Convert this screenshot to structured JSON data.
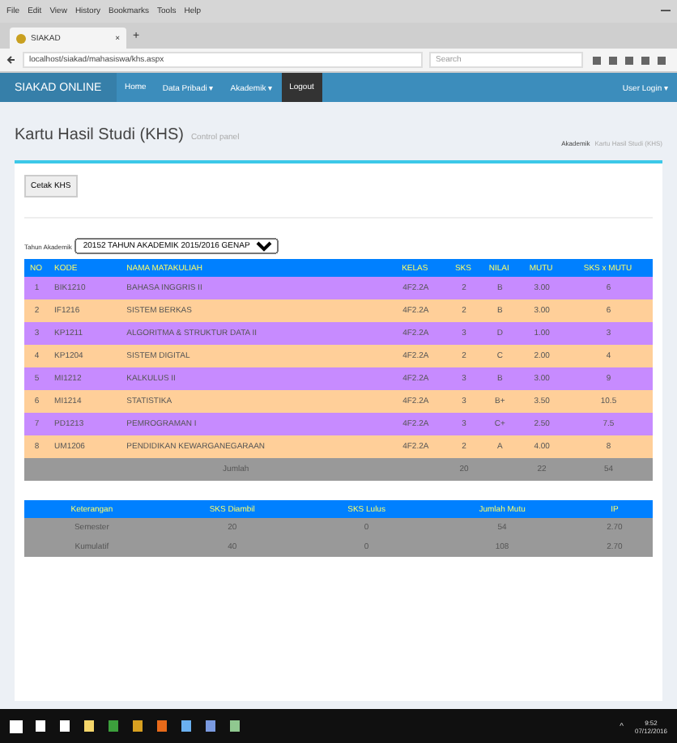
{
  "browser": {
    "menu": [
      "File",
      "Edit",
      "View",
      "History",
      "Bookmarks",
      "Tools",
      "Help"
    ],
    "tab": {
      "title": "SIAKAD",
      "close": "×"
    },
    "new_tab": "+",
    "url": "localhost/siakad/mahasiswa/khs.aspx",
    "search_placeholder": "Search"
  },
  "navbar": {
    "brand": "SIAKAD ONLINE",
    "items": [
      {
        "label": "Home",
        "selected": false
      },
      {
        "label": "Data Pribadi ▾",
        "selected": false
      },
      {
        "label": "Akademik ▾",
        "selected": false
      },
      {
        "label": "Logout",
        "selected": true
      }
    ],
    "user": "User Login ▾"
  },
  "header": {
    "title": "Kartu Hasil Studi (KHS)",
    "subtitle": "Control panel",
    "breadcrumb": [
      "Akademik",
      "Kartu Hasil Studi (KHS)"
    ]
  },
  "print_button": "Cetak KHS",
  "year": {
    "label": "Tahun Akademik",
    "value": "20152 TAHUN AKADEMIK 2015/2016 GENAP"
  },
  "grades": {
    "columns": [
      "NO",
      "KODE",
      "NAMA MATAKULIAH",
      "KELAS",
      "SKS",
      "NILAI",
      "MUTU",
      "SKS x MUTU"
    ],
    "rows": [
      [
        "1",
        "BIK1210",
        "BAHASA INGGRIS II",
        "4F2.2A",
        "2",
        "B",
        "3.00",
        "6"
      ],
      [
        "2",
        "IF1216",
        "SISTEM BERKAS",
        "4F2.2A",
        "2",
        "B",
        "3.00",
        "6"
      ],
      [
        "3",
        "KP1211",
        "ALGORITMA & STRUKTUR DATA II",
        "4F2.2A",
        "3",
        "D",
        "1.00",
        "3"
      ],
      [
        "4",
        "KP1204",
        "SISTEM DIGITAL",
        "4F2.2A",
        "2",
        "C",
        "2.00",
        "4"
      ],
      [
        "5",
        "MI1212",
        "KALKULUS II",
        "4F2.2A",
        "3",
        "B",
        "3.00",
        "9"
      ],
      [
        "6",
        "MI1214",
        "STATISTIKA",
        "4F2.2A",
        "3",
        "B+",
        "3.50",
        "10.5"
      ],
      [
        "7",
        "PD1213",
        "PEMROGRAMAN I",
        "4F2.2A",
        "3",
        "C+",
        "2.50",
        "7.5"
      ],
      [
        "8",
        "UM1206",
        "PENDIDIKAN KEWARGANEGARAAN",
        "4F2.2A",
        "2",
        "A",
        "4.00",
        "8"
      ]
    ],
    "total": {
      "label": "Jumlah",
      "sks": "20",
      "mutu": "22",
      "sks_mutu": "54"
    }
  },
  "summary": {
    "columns": [
      "Keterangan",
      "SKS Diambil",
      "SKS Lulus",
      "Jumlah Mutu",
      "IP"
    ],
    "rows": [
      [
        "Semester",
        "20",
        "0",
        "54",
        "2.70"
      ],
      [
        "Kumulatif",
        "40",
        "0",
        "108",
        "2.70"
      ]
    ]
  },
  "taskbar": {
    "tray": "^",
    "time": "9:52",
    "date": "07/12/2016"
  }
}
